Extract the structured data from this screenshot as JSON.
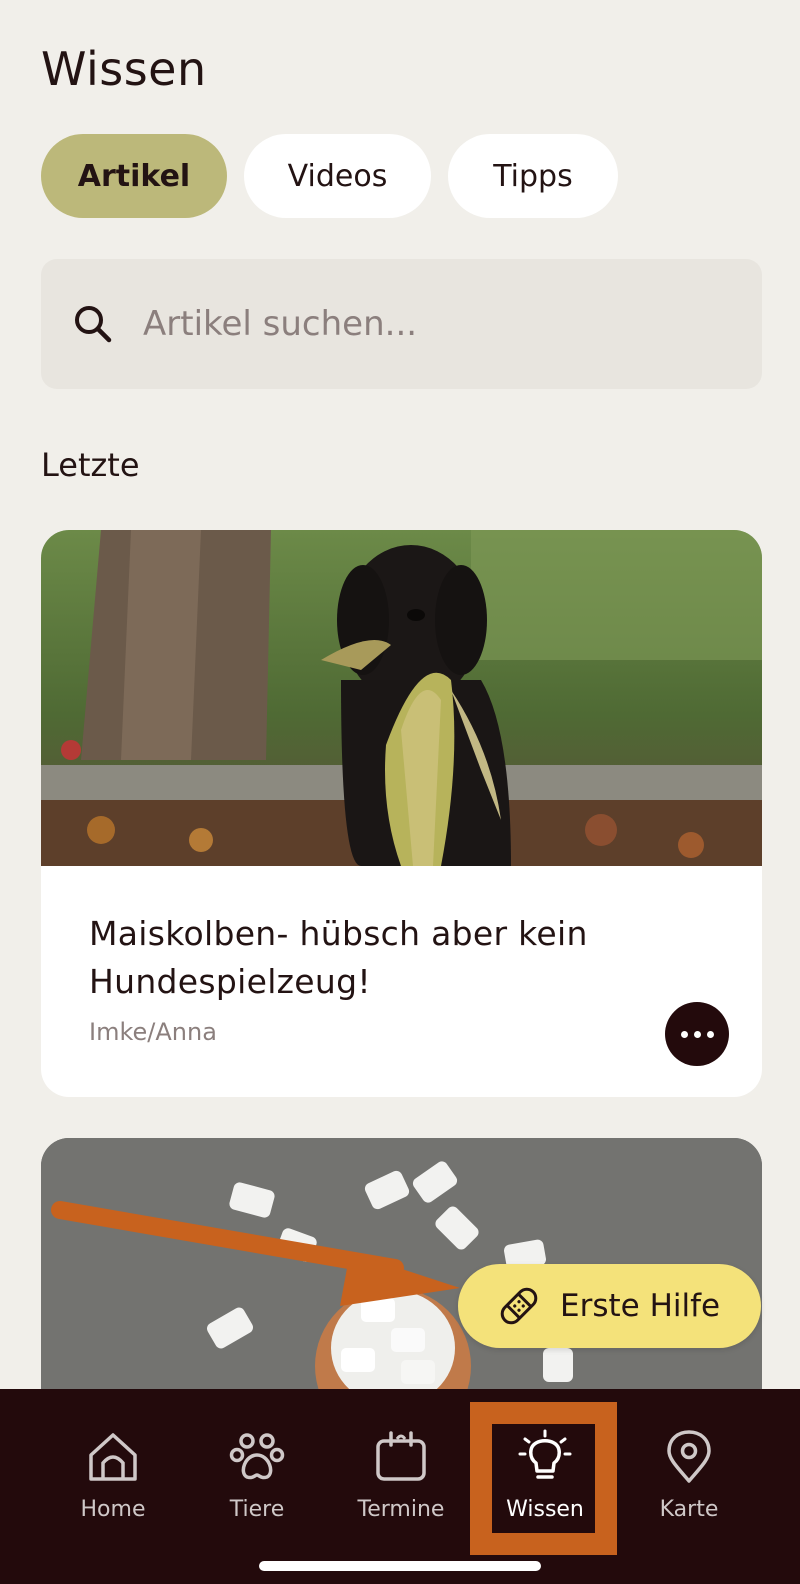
{
  "page": {
    "title": "Wissen"
  },
  "tabs": [
    {
      "label": "Artikel",
      "active": true
    },
    {
      "label": "Videos",
      "active": false
    },
    {
      "label": "Tipps",
      "active": false
    }
  ],
  "search": {
    "placeholder": "Artikel suchen...",
    "value": ""
  },
  "section": {
    "label": "Letzte"
  },
  "articles": [
    {
      "title": "Maiskolben- hübsch aber kein Hundespielzeug!",
      "author": "Imke/Anna",
      "image_icon": "dog-with-corn-photo"
    },
    {
      "image_icon": "chewing-gum-bowl-photo"
    }
  ],
  "fab": {
    "label": "Erste Hilfe",
    "icon": "bandage-icon"
  },
  "bottom_nav": {
    "items": [
      {
        "label": "Home",
        "icon": "home-icon",
        "active": false
      },
      {
        "label": "Tiere",
        "icon": "paw-icon",
        "active": false
      },
      {
        "label": "Termine",
        "icon": "calendar-icon",
        "active": false
      },
      {
        "label": "Wissen",
        "icon": "lightbulb-icon",
        "active": true
      },
      {
        "label": "Karte",
        "icon": "map-pin-icon",
        "active": false
      }
    ]
  },
  "colors": {
    "background": "#f1efea",
    "active_tab": "#bcb87a",
    "fab": "#f4e27a",
    "nav_background": "#230a0c",
    "annotation": "#c8621e"
  }
}
